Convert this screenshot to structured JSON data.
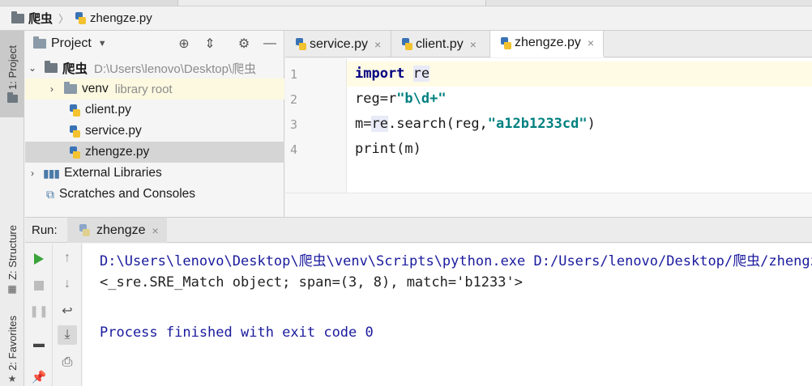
{
  "breadcrumb": {
    "project": "爬虫",
    "file": "zhengze.py"
  },
  "sidebar": {
    "tabs": [
      "1: Project",
      "Z: Structure",
      "2: Favorites"
    ]
  },
  "project_panel": {
    "title": "Project",
    "tree": {
      "root_name": "爬虫",
      "root_path": "D:\\Users\\lenovo\\Desktop\\爬虫",
      "venv_name": "venv",
      "venv_hint": "library root",
      "files": [
        "client.py",
        "service.py",
        "zhengze.py"
      ],
      "external": "External Libraries",
      "scratches": "Scratches and Consoles"
    }
  },
  "editor": {
    "tabs": [
      "service.py",
      "client.py",
      "zhengze.py"
    ],
    "active_tab": "zhengze.py",
    "line_numbers": [
      "1",
      "2",
      "3",
      "4"
    ],
    "code": {
      "l1_kw": "import",
      "l1_mod": "re",
      "l2_a": "reg=r",
      "l2_str": "\"b\\d+\"",
      "l3_a": "m=",
      "l3_mod": "re",
      "l3_b": ".search(reg,",
      "l3_str": "\"a12b1233cd\"",
      "l3_c": ")",
      "l4": "print(m)"
    }
  },
  "run": {
    "label": "Run:",
    "tab": "zhengze",
    "output": [
      "D:\\Users\\lenovo\\Desktop\\爬虫\\venv\\Scripts\\python.exe D:/Users/lenovo/Desktop/爬虫/zhengze.py",
      "<_sre.SRE_Match object; span=(3, 8), match='b1233'>",
      "",
      "Process finished with exit code 0"
    ]
  },
  "colors": {
    "keyword": "#000080",
    "string": "#008080",
    "console_text": "#1a1a9e",
    "run_green": "#3aa33a"
  }
}
